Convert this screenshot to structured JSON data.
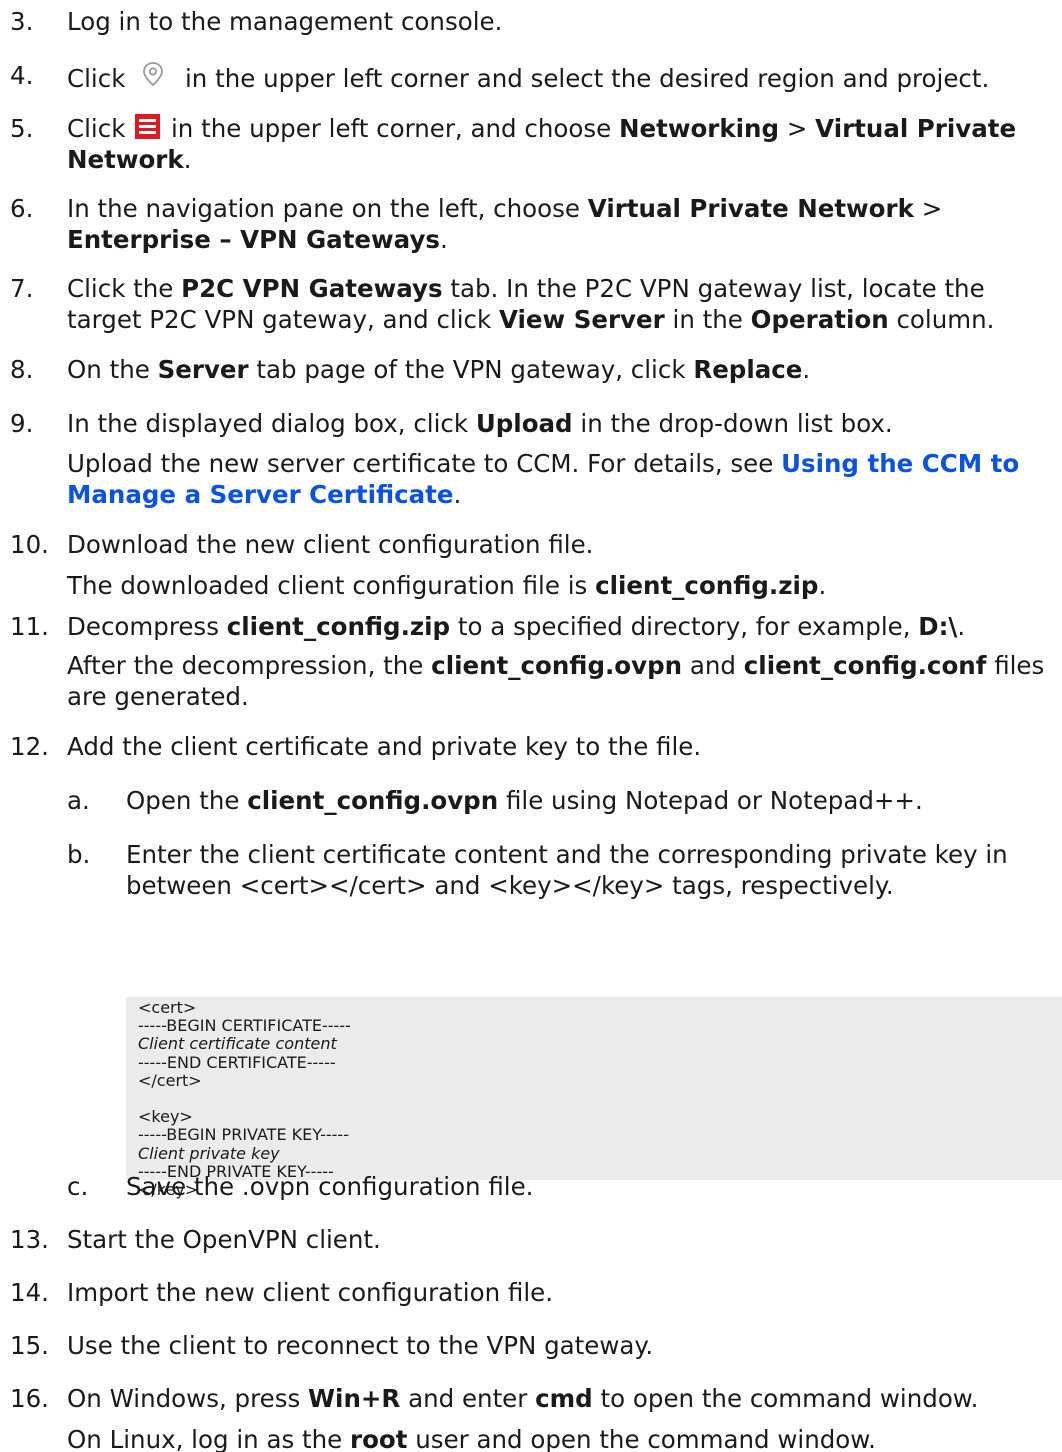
{
  "steps": {
    "s3": {
      "num": "3.",
      "text": "Log in to the management console."
    },
    "s4": {
      "num": "4.",
      "pre": "Click",
      "post": "in the upper left corner and select the desired region and project."
    },
    "s5": {
      "num": "5.",
      "pre": "Click",
      "mid": "in the upper left corner, and choose",
      "b1": "Networking",
      "sep": ">",
      "b2": "Virtual Private Network",
      "end": "."
    },
    "s6": {
      "num": "6.",
      "pre": "In the navigation pane on the left, choose",
      "b1": "Virtual Private Network",
      "sep": ">",
      "b2": "Enterprise – VPN Gateways",
      "end": "."
    },
    "s7": {
      "num": "7.",
      "pre": "Click the",
      "b1": "P2C VPN Gateways",
      "mid": "tab. In the P2C VPN gateway list, locate the target P2C VPN gateway, and click",
      "b2": "View Server",
      "mid2": "in the",
      "b3": "Operation",
      "end": "column."
    },
    "s8": {
      "num": "8.",
      "pre": "On the",
      "b1": "Server",
      "mid": "tab page of the VPN gateway, click",
      "b2": "Replace",
      "end": "."
    },
    "s9": {
      "num": "9.",
      "pre": "In the displayed dialog box, click",
      "b1": "Upload",
      "end": "in the drop-down list box.",
      "p2_pre": "Upload the new server certificate to CCM. For details, see",
      "p2_link": "Using the CCM to Manage a Server Certificate",
      "p2_end": "."
    },
    "s10": {
      "num": "10.",
      "text": "Download the new client configuration file.",
      "p2_pre": "The downloaded client configuration file is",
      "p2_b": "client_config.zip",
      "p2_end": "."
    },
    "s11": {
      "num": "11.",
      "pre": "Decompress",
      "b1": "client_config.zip",
      "mid": "to a specified directory, for example,",
      "b2": "D:\\",
      "end": ".",
      "p2_pre": "After the decompression, the",
      "p2_b1": "client_config.ovpn",
      "p2_mid": "and",
      "p2_b2": "client_config.conf",
      "p2_end": "files are generated."
    },
    "s12": {
      "num": "12.",
      "text": "Add the client certificate and private key to the file."
    },
    "s12a": {
      "num": "a.",
      "pre": "Open the",
      "b1": "client_config.ovpn",
      "end": "file using Notepad or Notepad++."
    },
    "s12b": {
      "num": "b.",
      "text": "Enter the client certificate content and the corresponding private key in between <cert></cert> and <key></key> tags, respectively."
    },
    "s12c": {
      "num": "c.",
      "text": "Save the .ovpn configuration file."
    },
    "s13": {
      "num": "13.",
      "text": "Start the OpenVPN client."
    },
    "s14": {
      "num": "14.",
      "text": "Import the new client configuration file."
    },
    "s15": {
      "num": "15.",
      "text": "Use the client to reconnect to the VPN gateway."
    },
    "s16": {
      "num": "16.",
      "pre": "On Windows, press",
      "b1": "Win+R",
      "mid": "and enter",
      "b2": "cmd",
      "end": "to open the command window.",
      "p2_pre": "On Linux, log in as the",
      "p2_b": "root",
      "p2_end": "user and open the command window."
    }
  },
  "code": {
    "l1": "<cert>",
    "l2": "-----BEGIN CERTIFICATE-----",
    "l3": "Client certificate content",
    "l4": "-----END CERTIFICATE-----",
    "l5": "</cert>",
    "l7": "<key>",
    "l8": "-----BEGIN PRIVATE KEY-----",
    "l9": "Client private key",
    "l10": "-----END PRIVATE KEY-----",
    "l11": "</key>"
  },
  "icons": {
    "location": "location-pin-icon",
    "menu": "hamburger-menu-icon"
  },
  "colors": {
    "link": "#0a52e0",
    "menu_icon_bg": "#e0191e",
    "code_bg": "#ebebeb"
  }
}
